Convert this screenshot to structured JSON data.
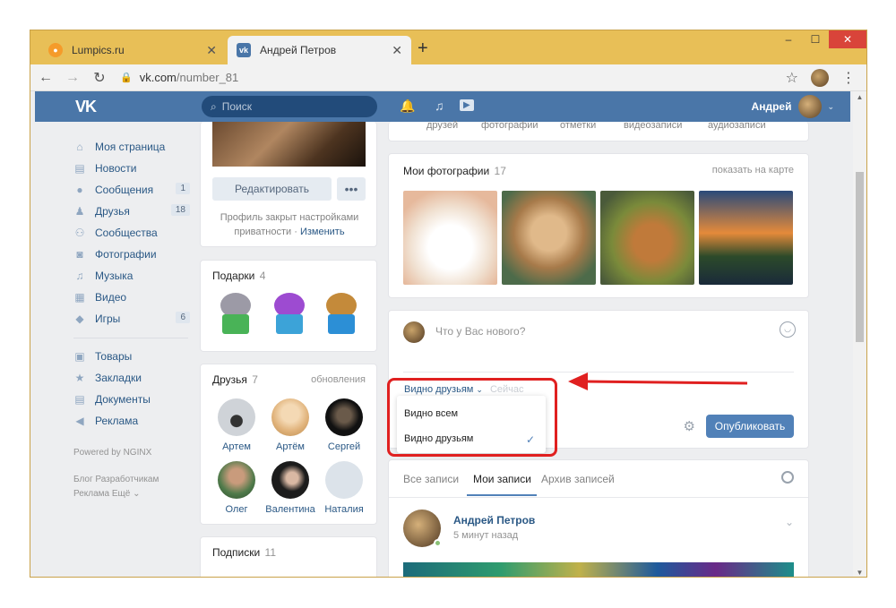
{
  "browser": {
    "tabs": [
      {
        "title": "Lumpics.ru",
        "favicon": "lumpics-icon"
      },
      {
        "title": "Андрей Петров",
        "favicon": "vk-icon"
      }
    ],
    "new_tab": "+",
    "window_buttons": {
      "minimize": "–",
      "maximize": "☐",
      "close": "✕"
    },
    "url_host": "vk.com",
    "url_path": "/number_81"
  },
  "vk": {
    "logo": "VK",
    "search_placeholder": "Поиск",
    "user_name": "Андрей",
    "accent": "#4a76a8"
  },
  "nav": {
    "items": [
      {
        "label": "Моя страница",
        "icon": "home-icon"
      },
      {
        "label": "Новости",
        "icon": "news-icon"
      },
      {
        "label": "Сообщения",
        "icon": "messages-icon",
        "count": "1"
      },
      {
        "label": "Друзья",
        "icon": "friends-icon",
        "count": "18"
      },
      {
        "label": "Сообщества",
        "icon": "communities-icon"
      },
      {
        "label": "Фотографии",
        "icon": "camera-icon"
      },
      {
        "label": "Музыка",
        "icon": "music-icon"
      },
      {
        "label": "Видео",
        "icon": "video-icon"
      },
      {
        "label": "Игры",
        "icon": "games-icon",
        "count": "6"
      }
    ],
    "items2": [
      {
        "label": "Товары",
        "icon": "shop-icon"
      },
      {
        "label": "Закладки",
        "icon": "star-icon"
      },
      {
        "label": "Документы",
        "icon": "document-icon"
      },
      {
        "label": "Реклама",
        "icon": "ads-icon"
      }
    ],
    "powered": "Powered by NGINX",
    "footer_line1": "Блог   Разработчикам",
    "footer_line2": "Реклама   Ещё ⌄"
  },
  "profile": {
    "edit_label": "Редактировать",
    "more_label": "•••",
    "closed_text": "Профиль закрыт настройками приватности",
    "change_link": "Изменить"
  },
  "gifts": {
    "title": "Подарки",
    "count": "4"
  },
  "friends": {
    "title": "Друзья",
    "count": "7",
    "updates": "обновления",
    "list": [
      "Артем",
      "Артём",
      "Сергей",
      "Олег",
      "Валентина",
      "Наталия"
    ]
  },
  "subs": {
    "title": "Подписки",
    "count": "11"
  },
  "top_tabs": [
    "друзей",
    "фотографии",
    "отметки",
    "видеозаписи",
    "аудиозаписи"
  ],
  "photos": {
    "title": "Мои фотографии",
    "count": "17",
    "map_link": "показать на карте"
  },
  "composer": {
    "placeholder": "Что у Вас нового?",
    "visibility": "Видно друзьям",
    "visibility_hidden": "Сейчас",
    "options": [
      "Видно всем",
      "Видно друзьям"
    ],
    "selected_option": "Видно друзьям",
    "publish": "Опубликовать"
  },
  "feed": {
    "tabs": [
      "Все записи",
      "Мои записи",
      "Архив записей"
    ],
    "active_tab": "Мои записи",
    "post_author": "Андрей Петров",
    "post_time": "5 минут назад"
  }
}
